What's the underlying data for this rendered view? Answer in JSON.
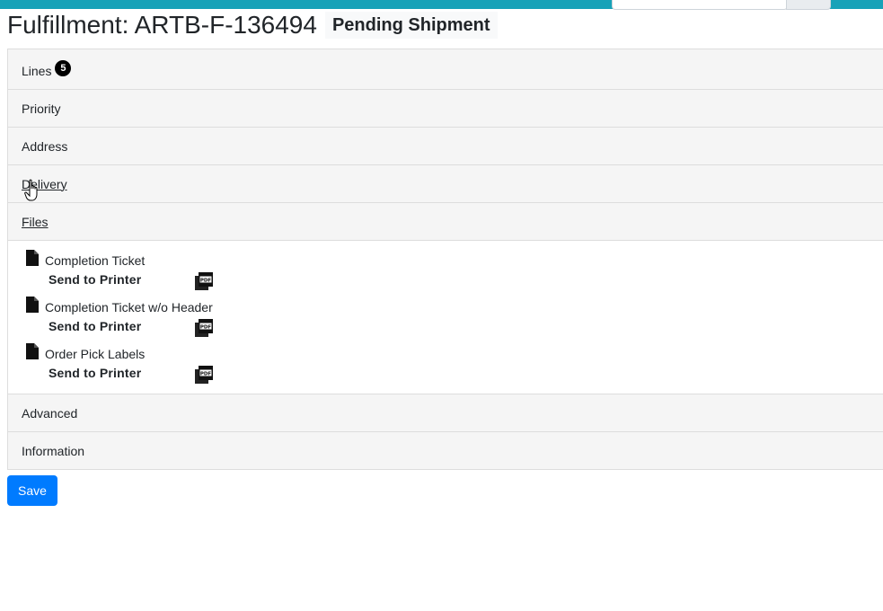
{
  "header": {
    "title": "Fulfillment: ARTB-F-136494",
    "status": "Pending Shipment"
  },
  "sections": {
    "lines": {
      "label": "Lines",
      "count": "5"
    },
    "priority": {
      "label": "Priority"
    },
    "address": {
      "label": "Address"
    },
    "delivery": {
      "label": "Delivery"
    },
    "files": {
      "label": "Files",
      "items": [
        {
          "name": "Completion Ticket",
          "action": "Send to Printer"
        },
        {
          "name": "Completion Ticket w/o Header",
          "action": "Send to Printer"
        },
        {
          "name": "Order Pick Labels",
          "action": "Send to Printer"
        }
      ]
    },
    "advanced": {
      "label": "Advanced"
    },
    "information": {
      "label": "Information"
    }
  },
  "actions": {
    "save_label": "Save"
  },
  "colors": {
    "topbar": "#17a2b8",
    "primary": "#007bff"
  }
}
